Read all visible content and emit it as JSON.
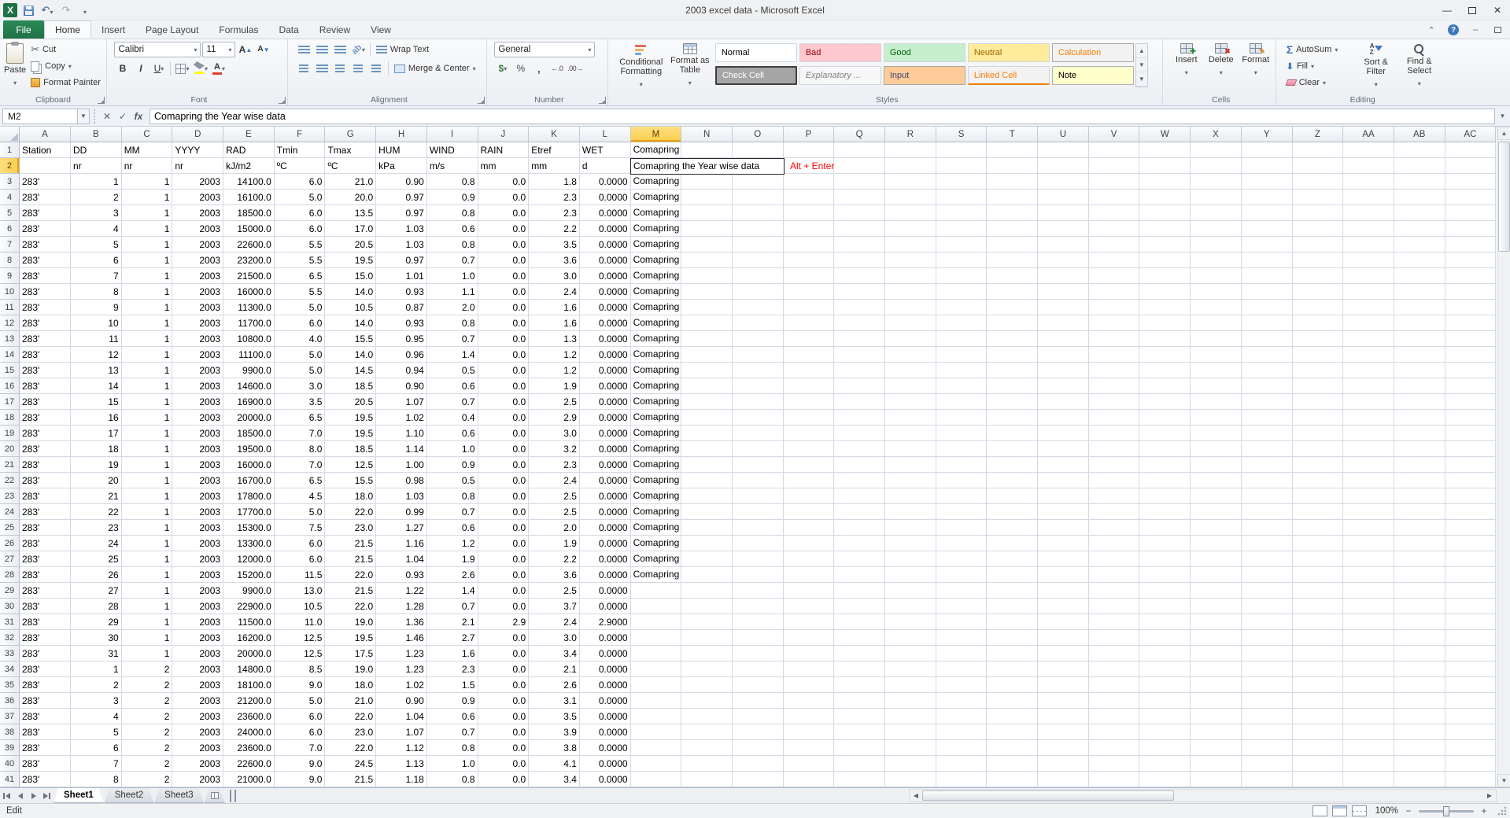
{
  "window": {
    "title": "2003 excel data  -  Microsoft Excel"
  },
  "ribbon": {
    "file_tab": "File",
    "tabs": [
      "Home",
      "Insert",
      "Page Layout",
      "Formulas",
      "Data",
      "Review",
      "View"
    ],
    "active_tab": "Home",
    "clipboard": {
      "label": "Clipboard",
      "paste": "Paste",
      "cut": "Cut",
      "copy": "Copy",
      "format_painter": "Format Painter"
    },
    "font": {
      "label": "Font",
      "family": "Calibri",
      "size": "11"
    },
    "alignment": {
      "label": "Alignment",
      "wrap_text": "Wrap Text",
      "merge_center": "Merge & Center"
    },
    "number": {
      "label": "Number",
      "format": "General"
    },
    "styles": {
      "label": "Styles",
      "conditional_formatting": "Conditional Formatting",
      "format_as_table": "Format as Table",
      "cell_styles": [
        {
          "label": "Normal",
          "style": "normal"
        },
        {
          "label": "Bad",
          "style": "bad"
        },
        {
          "label": "Good",
          "style": "good"
        },
        {
          "label": "Neutral",
          "style": "neutral"
        },
        {
          "label": "Calculation",
          "style": "calculation"
        },
        {
          "label": "Check Cell",
          "style": "check-cell"
        },
        {
          "label": "Explanatory ...",
          "style": "explanatory"
        },
        {
          "label": "Input",
          "style": "input"
        },
        {
          "label": "Linked Cell",
          "style": "linked-cell"
        },
        {
          "label": "Note",
          "style": "note"
        }
      ]
    },
    "cells": {
      "label": "Cells",
      "insert": "Insert",
      "delete": "Delete",
      "format": "Format"
    },
    "editing": {
      "label": "Editing",
      "autosum": "AutoSum",
      "fill": "Fill",
      "clear": "Clear",
      "sort_filter": "Sort & Filter",
      "find_select": "Find & Select"
    }
  },
  "formula_bar": {
    "name_box": "M2",
    "fx_label": "fx",
    "content": "Comapring the Year wise data"
  },
  "grid": {
    "active_cell": "M2",
    "selected_column": "M",
    "selected_row": 2,
    "edit_text": "Comapring the Year wise data",
    "annotation": {
      "cell": "P2",
      "text": "Alt + Enter",
      "color": "#FF0000"
    },
    "columns": [
      "A",
      "B",
      "C",
      "D",
      "E",
      "F",
      "G",
      "H",
      "I",
      "J",
      "K",
      "L",
      "M",
      "N",
      "O",
      "P",
      "Q",
      "R",
      "S",
      "T",
      "U",
      "V",
      "W",
      "X",
      "Y",
      "Z",
      "AA",
      "AB",
      "AC"
    ],
    "rows": [
      [
        "Station",
        "DD",
        "MM",
        "YYYY",
        "RAD",
        "Tmin",
        "Tmax",
        "HUM",
        "WIND",
        "RAIN",
        "Etref",
        "WET",
        "Comapring the Year wise data"
      ],
      [
        "",
        "nr",
        "nr",
        "nr",
        "kJ/m2",
        "ºC",
        "ºC",
        "kPa",
        "m/s",
        "mm",
        "mm",
        "d",
        ""
      ],
      [
        "283'",
        "1",
        "1",
        "2003",
        "14100.0",
        "6.0",
        "21.0",
        "0.90",
        "0.8",
        "0.0",
        "1.8",
        "0.0000",
        "Comapring the Year wise data"
      ],
      [
        "283'",
        "2",
        "1",
        "2003",
        "16100.0",
        "5.0",
        "20.0",
        "0.97",
        "0.9",
        "0.0",
        "2.3",
        "0.0000",
        "Comapring the Year wise data"
      ],
      [
        "283'",
        "3",
        "1",
        "2003",
        "18500.0",
        "6.0",
        "13.5",
        "0.97",
        "0.8",
        "0.0",
        "2.3",
        "0.0000",
        "Comapring the Year wise data"
      ],
      [
        "283'",
        "4",
        "1",
        "2003",
        "15000.0",
        "6.0",
        "17.0",
        "1.03",
        "0.6",
        "0.0",
        "2.2",
        "0.0000",
        "Comapring the Year wise data"
      ],
      [
        "283'",
        "5",
        "1",
        "2003",
        "22600.0",
        "5.5",
        "20.5",
        "1.03",
        "0.8",
        "0.0",
        "3.5",
        "0.0000",
        "Comapring the Year wise data"
      ],
      [
        "283'",
        "6",
        "1",
        "2003",
        "23200.0",
        "5.5",
        "19.5",
        "0.97",
        "0.7",
        "0.0",
        "3.6",
        "0.0000",
        "Comapring the Year wise data"
      ],
      [
        "283'",
        "7",
        "1",
        "2003",
        "21500.0",
        "6.5",
        "15.0",
        "1.01",
        "1.0",
        "0.0",
        "3.0",
        "0.0000",
        "Comapring the Year wise data"
      ],
      [
        "283'",
        "8",
        "1",
        "2003",
        "16000.0",
        "5.5",
        "14.0",
        "0.93",
        "1.1",
        "0.0",
        "2.4",
        "0.0000",
        "Comapring the Year wise data"
      ],
      [
        "283'",
        "9",
        "1",
        "2003",
        "11300.0",
        "5.0",
        "10.5",
        "0.87",
        "2.0",
        "0.0",
        "1.6",
        "0.0000",
        "Comapring the Year wise data"
      ],
      [
        "283'",
        "10",
        "1",
        "2003",
        "11700.0",
        "6.0",
        "14.0",
        "0.93",
        "0.8",
        "0.0",
        "1.6",
        "0.0000",
        "Comapring the Year wise data"
      ],
      [
        "283'",
        "11",
        "1",
        "2003",
        "10800.0",
        "4.0",
        "15.5",
        "0.95",
        "0.7",
        "0.0",
        "1.3",
        "0.0000",
        "Comapring the Year wise data"
      ],
      [
        "283'",
        "12",
        "1",
        "2003",
        "11100.0",
        "5.0",
        "14.0",
        "0.96",
        "1.4",
        "0.0",
        "1.2",
        "0.0000",
        "Comapring the Year wise data"
      ],
      [
        "283'",
        "13",
        "1",
        "2003",
        "9900.0",
        "5.0",
        "14.5",
        "0.94",
        "0.5",
        "0.0",
        "1.2",
        "0.0000",
        "Comapring the Year wise data"
      ],
      [
        "283'",
        "14",
        "1",
        "2003",
        "14600.0",
        "3.0",
        "18.5",
        "0.90",
        "0.6",
        "0.0",
        "1.9",
        "0.0000",
        "Comapring the Year wise data"
      ],
      [
        "283'",
        "15",
        "1",
        "2003",
        "16900.0",
        "3.5",
        "20.5",
        "1.07",
        "0.7",
        "0.0",
        "2.5",
        "0.0000",
        "Comapring the Year wise data"
      ],
      [
        "283'",
        "16",
        "1",
        "2003",
        "20000.0",
        "6.5",
        "19.5",
        "1.02",
        "0.4",
        "0.0",
        "2.9",
        "0.0000",
        "Comapring the Year wise data"
      ],
      [
        "283'",
        "17",
        "1",
        "2003",
        "18500.0",
        "7.0",
        "19.5",
        "1.10",
        "0.6",
        "0.0",
        "3.0",
        "0.0000",
        "Comapring the Year wise data"
      ],
      [
        "283'",
        "18",
        "1",
        "2003",
        "19500.0",
        "8.0",
        "18.5",
        "1.14",
        "1.0",
        "0.0",
        "3.2",
        "0.0000",
        "Comapring the Year wise data"
      ],
      [
        "283'",
        "19",
        "1",
        "2003",
        "16000.0",
        "7.0",
        "12.5",
        "1.00",
        "0.9",
        "0.0",
        "2.3",
        "0.0000",
        "Comapring the Year wise data"
      ],
      [
        "283'",
        "20",
        "1",
        "2003",
        "16700.0",
        "6.5",
        "15.5",
        "0.98",
        "0.5",
        "0.0",
        "2.4",
        "0.0000",
        "Comapring the Year wise data"
      ],
      [
        "283'",
        "21",
        "1",
        "2003",
        "17800.0",
        "4.5",
        "18.0",
        "1.03",
        "0.8",
        "0.0",
        "2.5",
        "0.0000",
        "Comapring the Year wise data"
      ],
      [
        "283'",
        "22",
        "1",
        "2003",
        "17700.0",
        "5.0",
        "22.0",
        "0.99",
        "0.7",
        "0.0",
        "2.5",
        "0.0000",
        "Comapring the Year wise data"
      ],
      [
        "283'",
        "23",
        "1",
        "2003",
        "15300.0",
        "7.5",
        "23.0",
        "1.27",
        "0.6",
        "0.0",
        "2.0",
        "0.0000",
        "Comapring the Year wise data"
      ],
      [
        "283'",
        "24",
        "1",
        "2003",
        "13300.0",
        "6.0",
        "21.5",
        "1.16",
        "1.2",
        "0.0",
        "1.9",
        "0.0000",
        "Comapring the Year wise data"
      ],
      [
        "283'",
        "25",
        "1",
        "2003",
        "12000.0",
        "6.0",
        "21.5",
        "1.04",
        "1.9",
        "0.0",
        "2.2",
        "0.0000",
        "Comapring the Year wise data"
      ],
      [
        "283'",
        "26",
        "1",
        "2003",
        "15200.0",
        "11.5",
        "22.0",
        "0.93",
        "2.6",
        "0.0",
        "3.6",
        "0.0000",
        "Comapring the Year wise data"
      ],
      [
        "283'",
        "27",
        "1",
        "2003",
        "9900.0",
        "13.0",
        "21.5",
        "1.22",
        "1.4",
        "0.0",
        "2.5",
        "0.0000",
        ""
      ],
      [
        "283'",
        "28",
        "1",
        "2003",
        "22900.0",
        "10.5",
        "22.0",
        "1.28",
        "0.7",
        "0.0",
        "3.7",
        "0.0000",
        ""
      ],
      [
        "283'",
        "29",
        "1",
        "2003",
        "11500.0",
        "11.0",
        "19.0",
        "1.36",
        "2.1",
        "2.9",
        "2.4",
        "2.9000",
        ""
      ],
      [
        "283'",
        "30",
        "1",
        "2003",
        "16200.0",
        "12.5",
        "19.5",
        "1.46",
        "2.7",
        "0.0",
        "3.0",
        "0.0000",
        ""
      ],
      [
        "283'",
        "31",
        "1",
        "2003",
        "20000.0",
        "12.5",
        "17.5",
        "1.23",
        "1.6",
        "0.0",
        "3.4",
        "0.0000",
        ""
      ],
      [
        "283'",
        "1",
        "2",
        "2003",
        "14800.0",
        "8.5",
        "19.0",
        "1.23",
        "2.3",
        "0.0",
        "2.1",
        "0.0000",
        ""
      ],
      [
        "283'",
        "2",
        "2",
        "2003",
        "18100.0",
        "9.0",
        "18.0",
        "1.02",
        "1.5",
        "0.0",
        "2.6",
        "0.0000",
        ""
      ],
      [
        "283'",
        "3",
        "2",
        "2003",
        "21200.0",
        "5.0",
        "21.0",
        "0.90",
        "0.9",
        "0.0",
        "3.1",
        "0.0000",
        ""
      ],
      [
        "283'",
        "4",
        "2",
        "2003",
        "23600.0",
        "6.0",
        "22.0",
        "1.04",
        "0.6",
        "0.0",
        "3.5",
        "0.0000",
        ""
      ],
      [
        "283'",
        "5",
        "2",
        "2003",
        "24000.0",
        "6.0",
        "23.0",
        "1.07",
        "0.7",
        "0.0",
        "3.9",
        "0.0000",
        ""
      ],
      [
        "283'",
        "6",
        "2",
        "2003",
        "23600.0",
        "7.0",
        "22.0",
        "1.12",
        "0.8",
        "0.0",
        "3.8",
        "0.0000",
        ""
      ],
      [
        "283'",
        "7",
        "2",
        "2003",
        "22600.0",
        "9.0",
        "24.5",
        "1.13",
        "1.0",
        "0.0",
        "4.1",
        "0.0000",
        ""
      ],
      [
        "283'",
        "8",
        "2",
        "2003",
        "21000.0",
        "9.0",
        "21.5",
        "1.18",
        "0.8",
        "0.0",
        "3.4",
        "0.0000",
        ""
      ]
    ]
  },
  "sheet_tabs": {
    "tabs": [
      "Sheet1",
      "Sheet2",
      "Sheet3"
    ],
    "active": "Sheet1"
  },
  "status_bar": {
    "mode": "Edit",
    "zoom": "100%"
  }
}
